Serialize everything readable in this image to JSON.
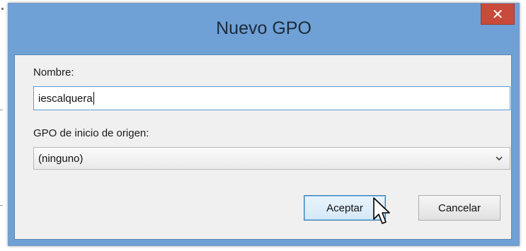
{
  "dialog": {
    "title": "Nuevo GPO",
    "close_icon": "close-icon"
  },
  "form": {
    "name_label": "Nombre:",
    "name_value": "iescalquera",
    "source_label": "GPO de inicio de origen:",
    "source_selected": "(ninguno)"
  },
  "buttons": {
    "accept_label": "Aceptar",
    "cancel_label": "Cancelar"
  },
  "colors": {
    "title_bar": "#6fa1d6",
    "close_button": "#c84a3a",
    "client_area": "#f0f0f0",
    "input_focus_border": "#5a9bd8"
  },
  "icons": {
    "close": "close-icon",
    "dropdown": "chevron-down-icon",
    "pointer": "mouse-pointer-icon"
  }
}
